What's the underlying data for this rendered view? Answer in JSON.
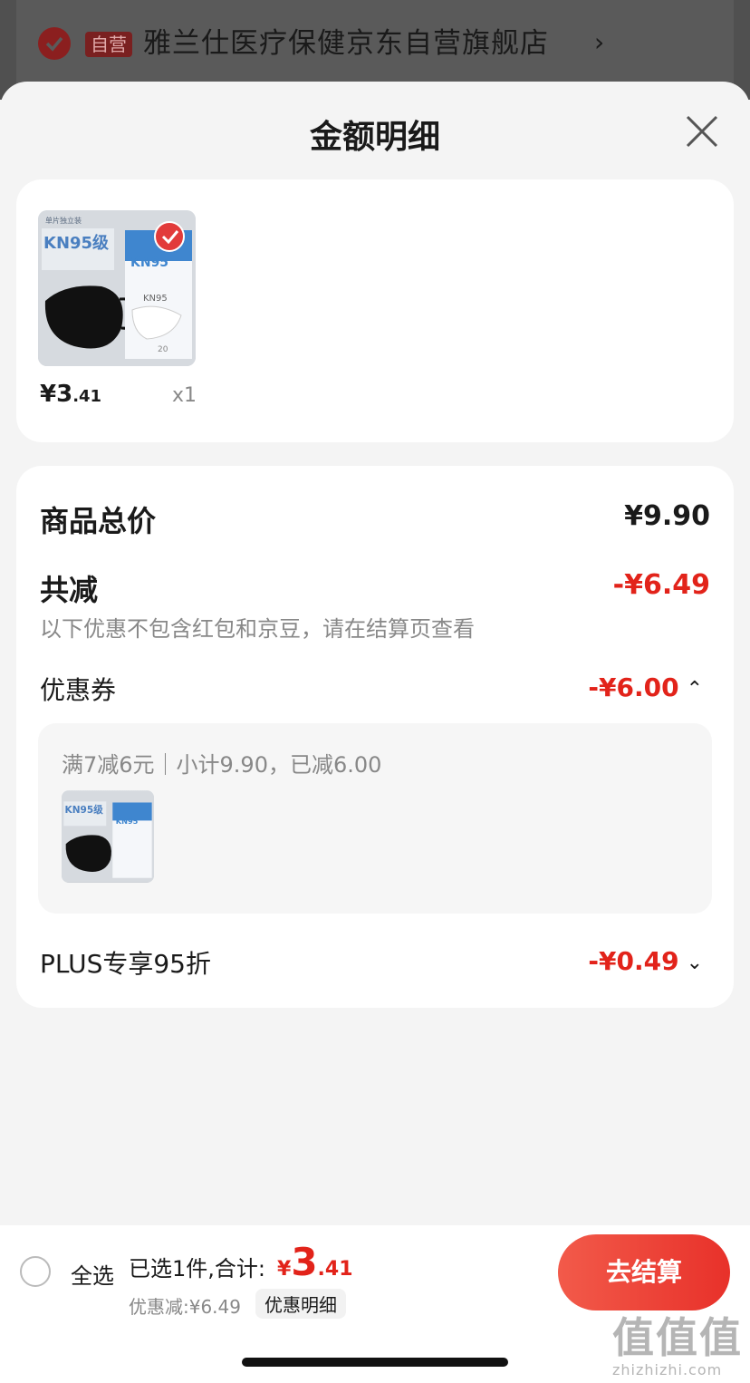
{
  "store": {
    "tag": "自营",
    "name": "雅兰仕医疗保健京东自营旗舰店",
    "arrow": "›"
  },
  "sheet": {
    "title": "金额明细"
  },
  "product": {
    "price_main": "¥3",
    "price_decimal": ".41",
    "quantity": "x1",
    "image_text": {
      "badge": "单片独立装",
      "kn95_grade": "KN95级",
      "box_brand": "KN95",
      "box_label": "KN95",
      "count": "20"
    }
  },
  "detail": {
    "goods_total_label": "商品总价",
    "goods_total_value": "¥9.90",
    "reduce_label": "共减",
    "reduce_value": "-¥6.49",
    "note": "以下优惠不包含红包和京豆，请在结算页查看",
    "coupon_label": "优惠券",
    "coupon_value": "-¥6.00",
    "coupon_chevron": "⌃",
    "coupon_desc": "满7减6元｜小计9.90，已减6.00",
    "plus_label": "PLUS专享95折",
    "plus_value": "-¥0.49",
    "plus_chevron": "⌄"
  },
  "bottom": {
    "select_all": "全选",
    "selected_text": "已选1件,合计:",
    "total_symbol": "¥",
    "total_main": "3",
    "total_decimal": ".41",
    "discount_text": "优惠减:¥6.49",
    "detail_pill": "优惠明细",
    "checkout": "去结算"
  },
  "watermark": {
    "big": "值值值",
    "small": "zhizhizhi.com"
  },
  "colors": {
    "accent_red": "#e2231a",
    "checkout_gradient_start": "#f25a4a",
    "checkout_gradient_end": "#e8312a"
  }
}
